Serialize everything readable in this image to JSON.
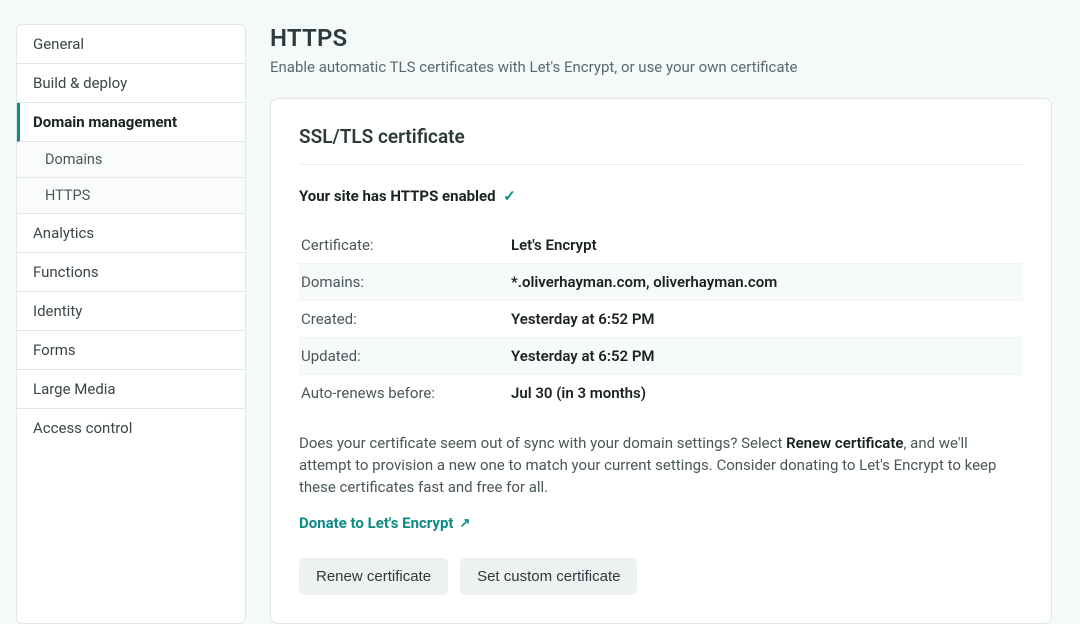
{
  "sidebar": {
    "items": [
      {
        "label": "General"
      },
      {
        "label": "Build & deploy"
      },
      {
        "label": "Domain management",
        "active": true
      },
      {
        "label": "Analytics"
      },
      {
        "label": "Functions"
      },
      {
        "label": "Identity"
      },
      {
        "label": "Forms"
      },
      {
        "label": "Large Media"
      },
      {
        "label": "Access control"
      }
    ],
    "subitems": [
      {
        "label": "Domains"
      },
      {
        "label": "HTTPS"
      }
    ]
  },
  "page": {
    "title": "HTTPS",
    "subtitle": "Enable automatic TLS certificates with Let's Encrypt, or use your own certificate"
  },
  "card": {
    "title": "SSL/TLS certificate",
    "status_text": "Your site has HTTPS enabled",
    "check_glyph": "✓",
    "rows": [
      {
        "k": "Certificate:",
        "v": "Let's Encrypt"
      },
      {
        "k": "Domains:",
        "v": "*.oliverhayman.com, oliverhayman.com"
      },
      {
        "k": "Created:",
        "v": "Yesterday at 6:52 PM"
      },
      {
        "k": "Updated:",
        "v": "Yesterday at 6:52 PM"
      },
      {
        "k": "Auto-renews before:",
        "v": "Jul 30 (in 3 months)"
      }
    ],
    "info_before": "Does your certificate seem out of sync with your domain settings? Select ",
    "info_strong": "Renew certificate",
    "info_after": ", and we'll attempt to provision a new one to match your current settings. Consider donating to Let's Encrypt to keep these certificates fast and free for all.",
    "donate_label": "Donate to Let's Encrypt",
    "external_glyph": "↗",
    "buttons": {
      "renew": "Renew certificate",
      "custom": "Set custom certificate"
    }
  }
}
